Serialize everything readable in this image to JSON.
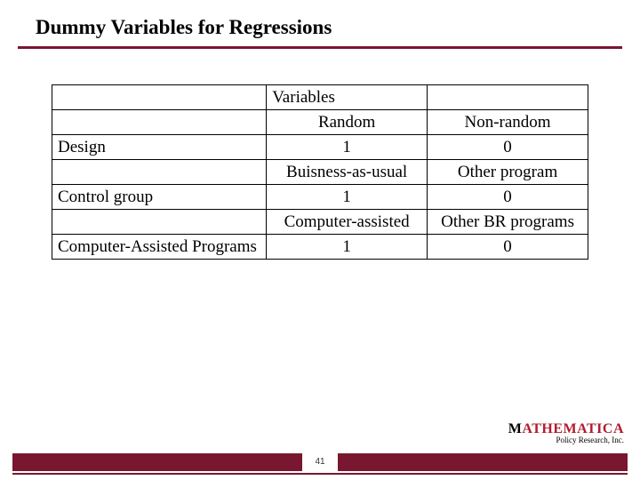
{
  "title": "Dummy Variables for Regressions",
  "table": {
    "variables_label": "Variables",
    "rows": [
      {
        "header_a": "Random",
        "header_b": "Non-random",
        "label": "Design",
        "val_a": "1",
        "val_b": "0"
      },
      {
        "header_a": "Buisness-as-usual",
        "header_b": "Other program",
        "label": "Control group",
        "val_a": "1",
        "val_b": "0"
      },
      {
        "header_a": "Computer-assisted",
        "header_b": "Other BR programs",
        "label": "Computer-Assisted Programs",
        "val_a": "1",
        "val_b": "0"
      }
    ]
  },
  "footer": {
    "page_number": "41",
    "brand_black": "M",
    "brand_red": "ATHEMATICA",
    "brand_sub": "Policy Research, Inc."
  }
}
